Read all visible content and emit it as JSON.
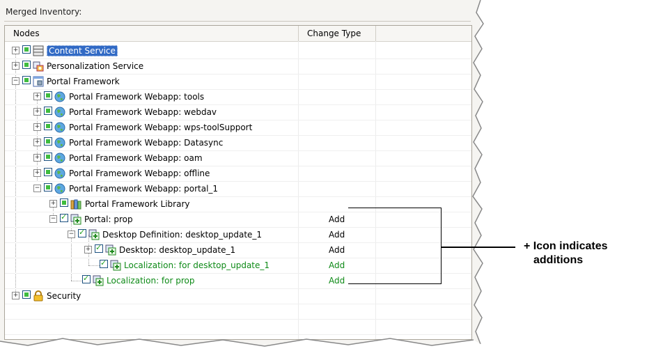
{
  "panel": {
    "title": "Merged Inventory:"
  },
  "columns": {
    "nodes": "Nodes",
    "change_type": "Change Type"
  },
  "tree": {
    "content_service": "Content Service",
    "personalization_service": "Personalization Service",
    "portal_framework": "Portal Framework",
    "webapp_tools": "Portal Framework Webapp: tools",
    "webapp_webdav": "Portal Framework Webapp: webdav",
    "webapp_wps": "Portal Framework Webapp: wps-toolSupport",
    "webapp_datasync": "Portal Framework Webapp: Datasync",
    "webapp_oam": "Portal Framework Webapp: oam",
    "webapp_offline": "Portal Framework Webapp: offline",
    "webapp_portal1": "Portal Framework Webapp: portal_1",
    "library": "Portal Framework Library",
    "portal_prop": "Portal: prop",
    "desktop_definition": "Desktop Definition: desktop_update_1",
    "desktop": "Desktop: desktop_update_1",
    "localization_desktop": "Localization: for desktop_update_1",
    "localization_prop": "Localization: for prop",
    "security": "Security"
  },
  "change": {
    "portal_prop": "Add",
    "desktop_definition": "Add",
    "desktop": "Add",
    "localization_desktop": "Add",
    "localization_prop": "Add"
  },
  "annotation": {
    "line1": "+ Icon indicates",
    "line2": "additions"
  },
  "colors": {
    "selection": "#316ac5",
    "added_text": "#0e8a17",
    "checkbox_fill": "#3fbc3f"
  },
  "icons": [
    "server-icon",
    "personalization-icon",
    "framework-icon",
    "globe-icon",
    "library-icon",
    "add-node-icon",
    "lock-icon"
  ]
}
